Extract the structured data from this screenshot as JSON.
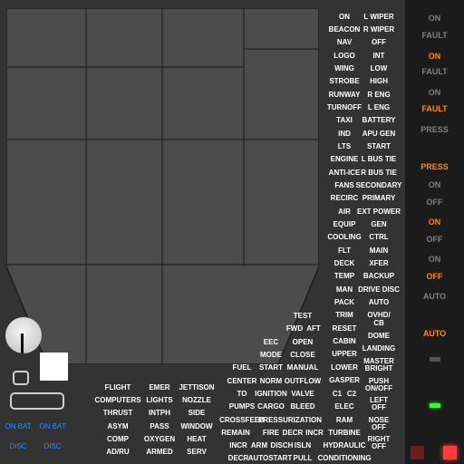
{
  "bat_buttons": [
    {
      "top": "ON BAT",
      "bottom": "DISC"
    },
    {
      "top": "ON BAT",
      "bottom": "DISC"
    }
  ],
  "colors": {
    "annunciator_on": "#ff8a1f",
    "annunciator_off": "#808080",
    "bat": "#2b8fff",
    "green": "#33ff33",
    "red": "#ff3b3b"
  },
  "words": {
    "col_a": [
      "ON",
      "BEACON",
      "NAV",
      "LOGO",
      "WING",
      "STROBE",
      "RUNWAY",
      "TURNOFF",
      "TAXI",
      "IND",
      "LTS",
      "ENGINE",
      "ANTI-ICE",
      "FANS",
      "RECIRC",
      "AIR",
      "EQUIP",
      "COOLING",
      "FLT",
      "DECK",
      "TEMP",
      "MAN",
      "PACK",
      "TRIM",
      "RESET",
      "CABIN",
      "UPPER",
      "LOWER",
      "GASPER",
      "C1",
      "C2",
      "ELEC",
      "TURBINE",
      "HYDRAULIC",
      "CONDITIONING"
    ],
    "col_b": [
      "L WIPER",
      "R WIPER",
      "OFF",
      "INT",
      "LOW",
      "HIGH",
      "R ENG",
      "L ENG",
      "BATTERY",
      "APU GEN",
      "START",
      "L BUS TIE",
      "R BUS TIE",
      "SECONDARY",
      "PRIMARY",
      "EXT POWER",
      "GEN",
      "CTRL",
      "MAIN",
      "XFER",
      "BACKUP",
      "DRIVE DISC",
      "AUTO",
      "OVHD/",
      "CB",
      "DOME",
      "LANDING",
      "MASTER",
      "BRIGHT",
      "PUSH",
      "ON/OFF",
      "LEFT",
      "OFF",
      "NOSE",
      "OFF",
      "RIGHT",
      "OFF"
    ],
    "middle": [
      "TEST",
      "FWD",
      "AFT",
      "EEC",
      "OPEN",
      "MODE",
      "CLOSE",
      "FUEL",
      "START",
      "MANUAL",
      "CENTER",
      "NORM",
      "OUTFLOW",
      "TO",
      "IGNITION",
      "VALVE",
      "PUMPS",
      "CARGO",
      "BLEED",
      "CROSSFEED",
      "PRESSURIZATION",
      "RAM",
      "REMAIN",
      "FIRE",
      "DECR",
      "INCR",
      "INCR",
      "ARM",
      "DISCH",
      "ISLN",
      "DECR",
      "AUTOSTART",
      "PULL"
    ],
    "lower_left": [
      "FLIGHT",
      "EMER",
      "JETTISON",
      "COMPUTERS",
      "LIGHTS",
      "NOZZLE",
      "THRUST",
      "INTPH",
      "SIDE",
      "ASYM",
      "PASS",
      "WINDOW",
      "COMP",
      "OXYGEN",
      "HEAT",
      "AD/RU",
      "ARMED",
      "SERV"
    ]
  },
  "annunciators": [
    "ON",
    "FAULT",
    "ON",
    "FAULT",
    "ON",
    "FAULT",
    "PRESS",
    "PRESS",
    "ON",
    "OFF",
    "ON",
    "OFF",
    "ON",
    "OFF",
    "AUTO",
    "AUTO"
  ]
}
